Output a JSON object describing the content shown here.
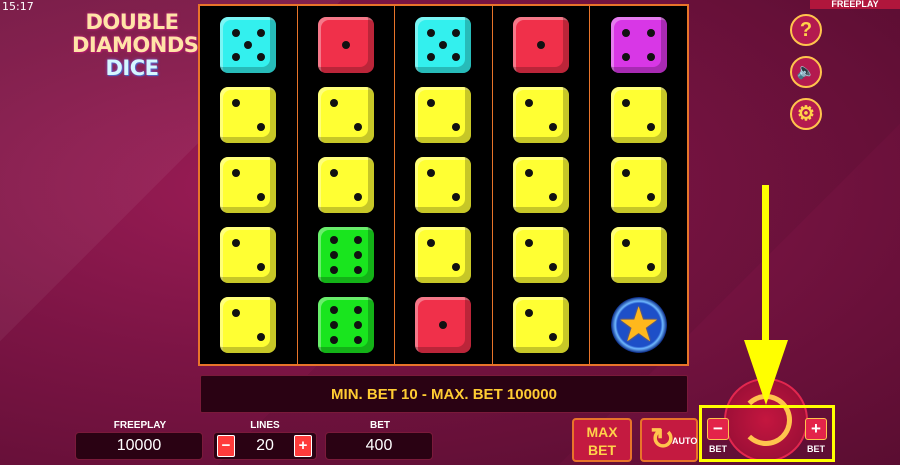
{
  "status": {
    "time": "15:17",
    "mode": "FREEPLAY"
  },
  "logo": {
    "line1": "DOUBLE",
    "line2": "DIAMONDS",
    "line3": "DICE"
  },
  "colors": {
    "yellow": "#ffff33",
    "cyan": "#33f0ee",
    "red": "#f0304a",
    "green": "#19e51e",
    "magenta": "#d837e6",
    "accent": "#ffcc33",
    "reel_border": "#e8742a"
  },
  "reels": [
    [
      {
        "color": "cyan",
        "face": 5
      },
      {
        "color": "yellow",
        "face": 2
      },
      {
        "color": "yellow",
        "face": 2
      },
      {
        "color": "yellow",
        "face": 2
      },
      {
        "color": "yellow",
        "face": 2
      }
    ],
    [
      {
        "color": "red",
        "face": 1
      },
      {
        "color": "yellow",
        "face": 2
      },
      {
        "color": "yellow",
        "face": 2
      },
      {
        "color": "green",
        "face": 6
      },
      {
        "color": "green",
        "face": 6
      }
    ],
    [
      {
        "color": "cyan",
        "face": 5
      },
      {
        "color": "yellow",
        "face": 2
      },
      {
        "color": "yellow",
        "face": 2
      },
      {
        "color": "yellow",
        "face": 2
      },
      {
        "color": "red",
        "face": 1
      }
    ],
    [
      {
        "color": "red",
        "face": 1
      },
      {
        "color": "yellow",
        "face": 2
      },
      {
        "color": "yellow",
        "face": 2
      },
      {
        "color": "yellow",
        "face": 2
      },
      {
        "color": "yellow",
        "face": 2
      }
    ],
    [
      {
        "color": "magenta",
        "face": 4
      },
      {
        "color": "yellow",
        "face": 2
      },
      {
        "color": "yellow",
        "face": 2
      },
      {
        "color": "yellow",
        "face": 2
      },
      {
        "color": "star",
        "face": 0
      }
    ]
  ],
  "info_message": "MIN. BET 10 - MAX. BET 100000",
  "balance": {
    "label": "FREEPLAY",
    "value": "10000"
  },
  "lines": {
    "label": "LINES",
    "value": "20",
    "minus": "−",
    "plus": "+"
  },
  "bet": {
    "label": "BET",
    "value": "400"
  },
  "buttons": {
    "help": "?",
    "sound": "🔈",
    "settings": "⚙",
    "max_bet_line1": "MAX",
    "max_bet_line2": "BET",
    "auto": "AUTO",
    "auto_icon": "↻",
    "bet_minus": "−",
    "bet_plus": "+",
    "bet_minus_label": "BET",
    "bet_plus_label": "BET"
  },
  "icons": [
    "help-icon",
    "sound-muted-icon",
    "settings-gear-icon",
    "spin-refresh-icon",
    "auto-refresh-icon",
    "star-icon"
  ]
}
